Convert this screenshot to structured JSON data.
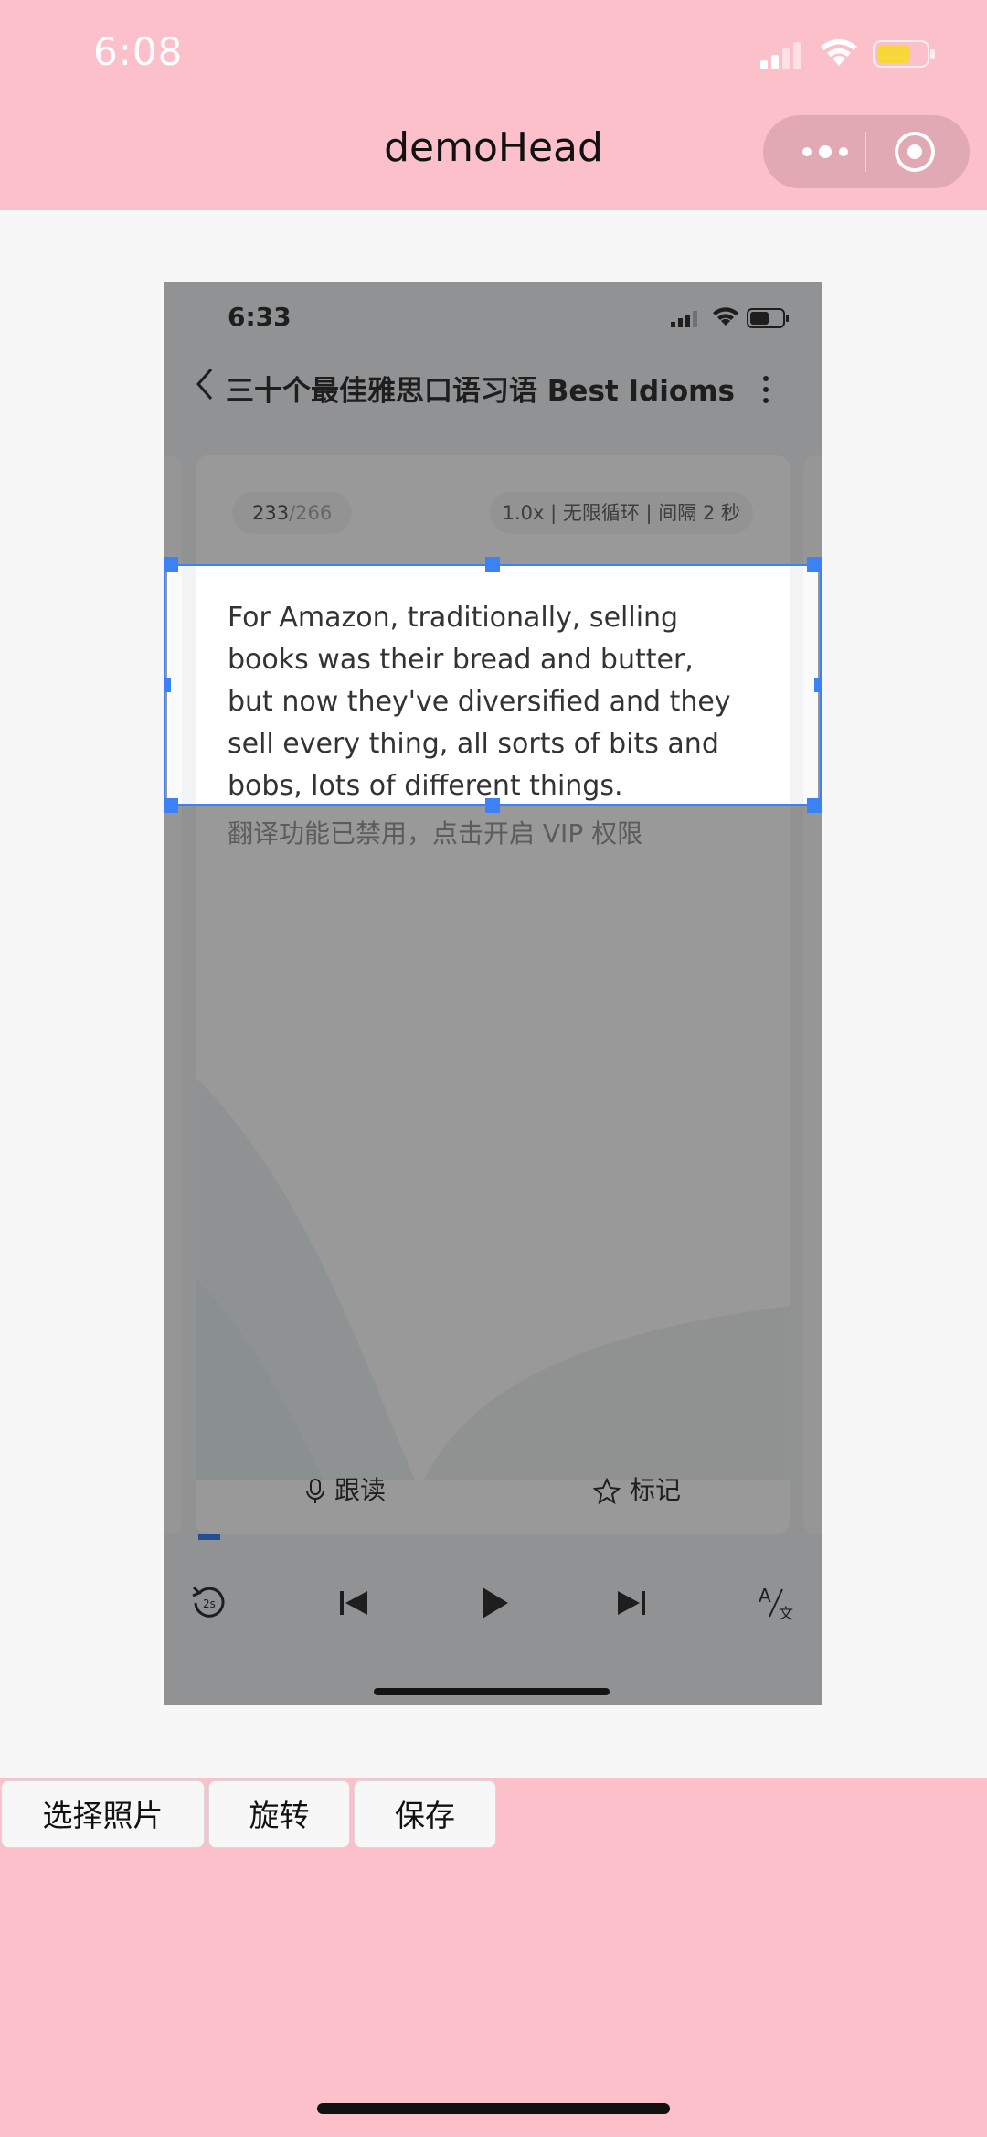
{
  "status_bar": {
    "time": "6:08"
  },
  "nav": {
    "title": "demoHead"
  },
  "photo": {
    "status_time": "6:33",
    "title": "三十个最佳雅思口语习语 Best Idioms...",
    "counter_current": "233",
    "counter_total": "/266",
    "playback_mode": "1.0x | 无限循环 | 间隔 2 秒",
    "sentence": "For Amazon, traditionally, selling books was their bread and butter, but now they've diversified and they sell every thing, all sorts of bits and bobs, lots of different things.",
    "vip_notice": "翻译功能已禁用，点击开启 VIP 权限",
    "follow_read_label": "跟读",
    "mark_label": "标记"
  },
  "buttons": {
    "choose_photo": "选择照片",
    "rotate": "旋转",
    "save": "保存"
  },
  "colors": {
    "background": "#fcc0cb",
    "editor_bg": "#f7f7f7",
    "crop_accent": "#3b82f6"
  }
}
